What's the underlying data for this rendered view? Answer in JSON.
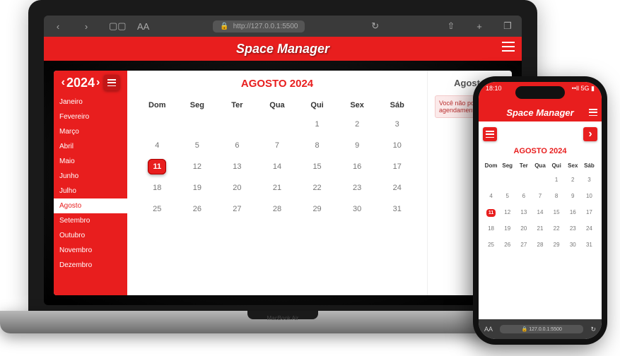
{
  "browser": {
    "url": "http://127.0.0.1:5500",
    "text_size": "AA"
  },
  "app": {
    "title": "Space Manager"
  },
  "sidebar": {
    "year": "2024",
    "months": [
      "Janeiro",
      "Fevereiro",
      "Março",
      "Abril",
      "Maio",
      "Junho",
      "Julho",
      "Agosto",
      "Setembro",
      "Outubro",
      "Novembro",
      "Dezembro"
    ],
    "active_index": 7
  },
  "calendar": {
    "title": "AGOSTO 2024",
    "days_of_week": [
      "Dom",
      "Seg",
      "Ter",
      "Qua",
      "Qui",
      "Sex",
      "Sáb"
    ],
    "weeks": [
      [
        "",
        "",
        "",
        "",
        "1",
        "2",
        "3"
      ],
      [
        "4",
        "5",
        "6",
        "7",
        "8",
        "9",
        "10"
      ],
      [
        "11",
        "12",
        "13",
        "14",
        "15",
        "16",
        "17"
      ],
      [
        "18",
        "19",
        "20",
        "21",
        "22",
        "23",
        "24"
      ],
      [
        "25",
        "26",
        "27",
        "28",
        "29",
        "30",
        "31"
      ]
    ],
    "today": "11"
  },
  "side_panel": {
    "title": "Agosto",
    "notice": "Você não possui agendamento para"
  },
  "phone": {
    "time": "18:10",
    "url": "127.0.0.1:5500",
    "text_size": "AA"
  },
  "laptop_model": "MacBook Air"
}
